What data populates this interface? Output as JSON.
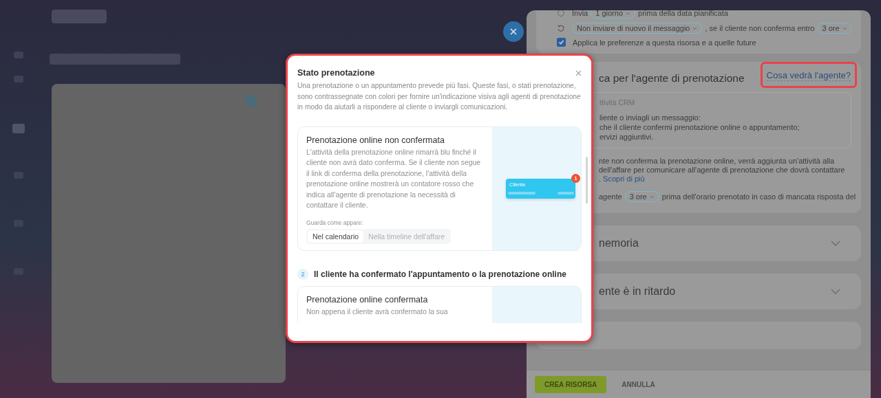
{
  "panel": {
    "send_row": {
      "prefix": "Invia",
      "select": "1 giorno",
      "suffix": "prima della data pianificata"
    },
    "repeat_row": {
      "select": "Non inviare di nuovo il messaggio",
      "middle": ", se il cliente non conferma entro",
      "select_2": "3 ore"
    },
    "apply_checkbox": {
      "label": "Applica le preferenze a questa risorsa e a quelle future",
      "checked": true
    },
    "agent_section": {
      "title": "ca per l'agente di prenotazione",
      "link": "Cosa vedrà l'agente?",
      "box_title": "ttività CRM",
      "box_lines": [
        "liente o inviagli un messaggio:",
        "che il cliente confermi prenotazione online o appuntamento;",
        "ervizi aggiuntivi."
      ],
      "info_lines": [
        "nte non conferma la prenotazione online, verrà aggiunta un'attività alla",
        "dell'affare per comunicare all'agente di prenotazione che dovrà contattare"
      ],
      "info_end": ".",
      "learn_more": "Scopri di più",
      "notify_prefix": "agente",
      "notify_select": "3 ore",
      "notify_suffix": "prima dell'orario prenotato in caso di mancata risposta del"
    },
    "accordions": [
      {
        "title": "nemoria",
        "expanded": false
      },
      {
        "title": "ente è in ritardo",
        "expanded": false
      }
    ],
    "buttons": [
      {
        "label": "CREA RISORSA",
        "kind": "primary"
      },
      {
        "label": "ANNULLA",
        "kind": "secondary"
      }
    ]
  },
  "dialog": {
    "title": "Stato prenotazione",
    "description": "Una prenotazione o un appuntamento prevede più fasi. Queste fasi, o stati prenotazione, sono contrassegnate con colori per fornire un'indicazione visiva agli agenti di prenotazione in modo da aiutarli a rispondere al cliente o inviargli comunicazioni.",
    "card": {
      "title": "Prenotazione online non confermata",
      "body": "L'attività della prenotazione online rimarrà blu finché il cliente non avrà dato conferma. Se il cliente non segue il link di conferma della prenotazione, l'attività della prenotazione online mostrerà un contatore rosso che indica all'agente di prenotazione la necessità di contattare il cliente.",
      "preview_label": "Guarda come appare:",
      "view_tabs": [
        {
          "label": "Nel calendario",
          "selected": true
        },
        {
          "label": "Nella timeline dell'affare",
          "selected": false
        }
      ],
      "illustration": {
        "label": "Cliente",
        "badge": "1"
      }
    },
    "step": {
      "number": "2",
      "title": "Il cliente ha confermato l'appuntamento o la prenotazione online"
    },
    "card_2": {
      "title": "Prenotazione online confermata",
      "body": "Non appena il cliente avrà confermato la sua"
    }
  }
}
